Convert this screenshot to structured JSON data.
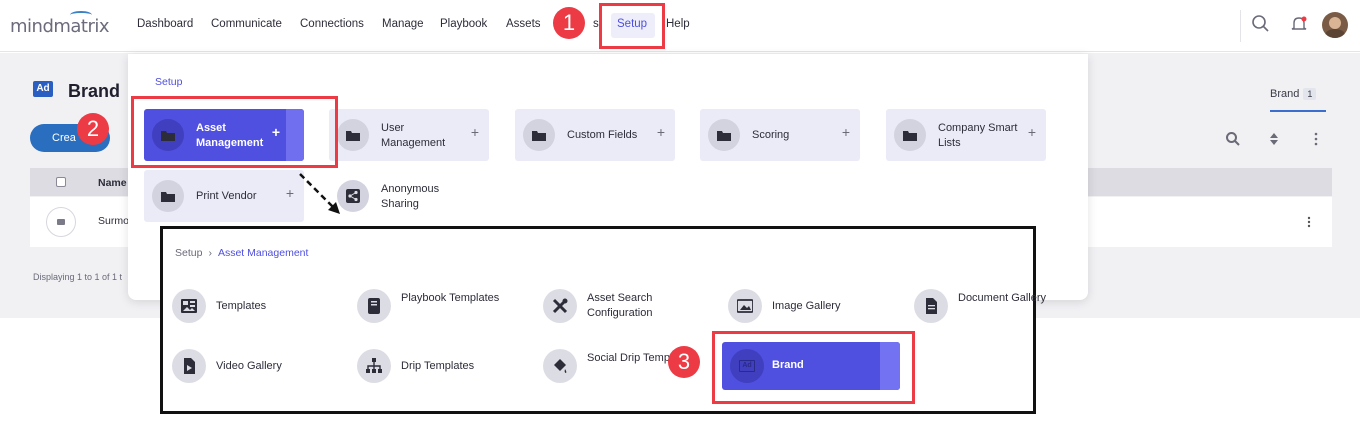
{
  "header": {
    "logo": "mindmatrix",
    "nav": [
      "Dashboard",
      "Communicate",
      "Connections",
      "Manage",
      "Playbook",
      "Assets",
      "s",
      "Setup",
      "Help"
    ],
    "active_nav": "Setup"
  },
  "page": {
    "badge": "Ad",
    "title": "Brand",
    "create_label": "Crea",
    "tab_label": "Brand",
    "tab_count": "1",
    "column_name": "Name",
    "row_name": "Surmo",
    "footer": "Displaying 1 to 1 of 1 t"
  },
  "setup_menu": {
    "title": "Setup",
    "items": [
      {
        "label": "Asset Management",
        "plus": "+"
      },
      {
        "label": "User Management",
        "plus": "+"
      },
      {
        "label": "Custom Fields",
        "plus": "+"
      },
      {
        "label": "Scoring",
        "plus": "+"
      },
      {
        "label": "Company Smart Lists",
        "plus": "+"
      },
      {
        "label": "Print Vendor",
        "plus": "+"
      },
      {
        "label": "Anonymous Sharing"
      }
    ]
  },
  "asset_management": {
    "breadcrumb": [
      "Setup",
      "Asset Management"
    ],
    "items": [
      {
        "label": "Templates"
      },
      {
        "label": "Playbook Templates"
      },
      {
        "label": "Asset Search Configuration"
      },
      {
        "label": "Image Gallery"
      },
      {
        "label": "Document Gallery"
      },
      {
        "label": "Video Gallery"
      },
      {
        "label": "Drip Templates"
      },
      {
        "label": "Social Drip Templates"
      },
      {
        "label": "Brand",
        "icon_text": "Ad"
      }
    ]
  },
  "callouts": [
    "1",
    "2",
    "3"
  ],
  "colors": {
    "accent": "#4f4fe0",
    "callout": "#ec3b45"
  }
}
